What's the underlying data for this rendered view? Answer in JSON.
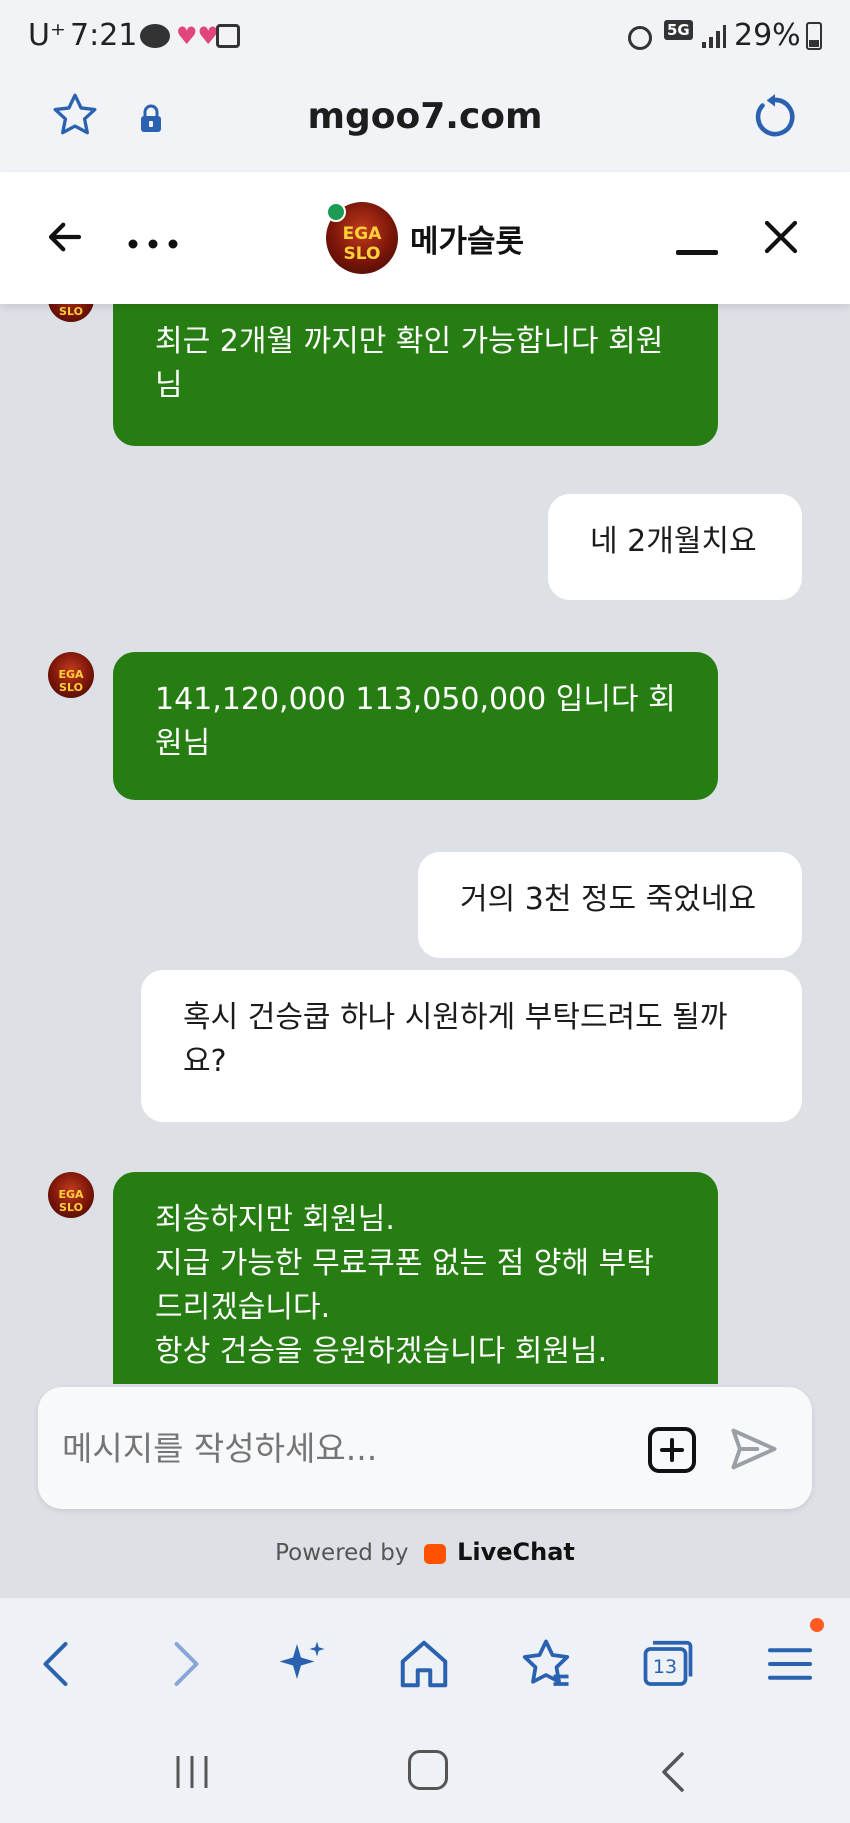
{
  "status_bar": {
    "carrier": "U⁺",
    "time": "7:21",
    "network": "5G",
    "battery": "29%"
  },
  "browser": {
    "url": "mgoo7.com"
  },
  "chat_header": {
    "agent_name": "메가슬롯",
    "avatar_text": "EGA SLO"
  },
  "messages": [
    {
      "side": "agent",
      "text": "최근 2개월 까지만 확인 가능합니다 회원\n님"
    },
    {
      "side": "user",
      "text": "네 2개월치요"
    },
    {
      "side": "agent",
      "text": "141,120,000 113,050,000 입니다 회\n원님"
    },
    {
      "side": "user",
      "text": "거의 3천 정도 죽었네요"
    },
    {
      "side": "user",
      "text": "혹시 건승쿱 하나 시원하게 부탁드려도 될까\n요?"
    },
    {
      "side": "agent",
      "text": "죄송하지만 회원님.\n지급 가능한 무료쿠폰 없는 점 양해 부탁\n드리겠습니다.\n항상 건승을 응원하겠습니다 회원님."
    }
  ],
  "composer": {
    "placeholder": "메시지를 작성하세요..."
  },
  "footer": {
    "powered_by": "Powered by",
    "brand": "LiveChat"
  },
  "bottom_nav": {
    "tab_count": "13"
  },
  "colors": {
    "agent_bubble": "#267d12",
    "user_bubble": "#ffffff",
    "chat_bg": "#dde1e6",
    "accent_blue": "#2a62b0",
    "online_dot": "#1e9b52",
    "livechat_orange": "#ff5100"
  }
}
